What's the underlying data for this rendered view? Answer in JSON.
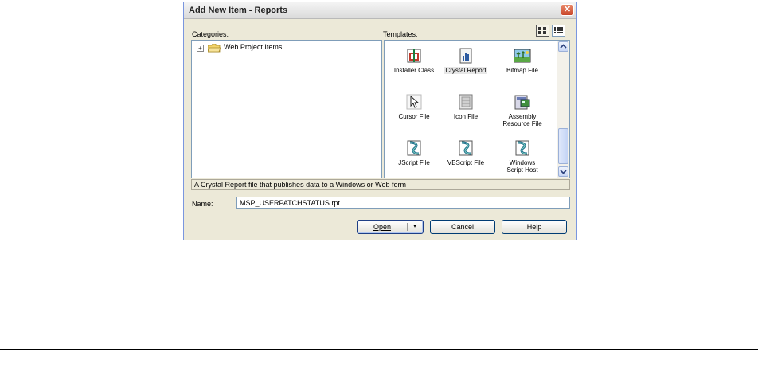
{
  "window": {
    "title": "Add New Item - Reports",
    "close_glyph": "✕"
  },
  "categories": {
    "label": "Categories:",
    "items": [
      {
        "label": "Web Project Items",
        "expander": "+",
        "icon": "folder-icon"
      }
    ]
  },
  "templates": {
    "label": "Templates:",
    "view_modes": [
      "large-icons",
      "small-icons"
    ],
    "items": [
      {
        "label": "Installer Class",
        "icon": "installer-class-icon"
      },
      {
        "label": "Crystal Report",
        "icon": "crystal-report-icon",
        "selected": true
      },
      {
        "label": "Bitmap File",
        "icon": "bitmap-file-icon"
      },
      {
        "label": "Cursor File",
        "icon": "cursor-file-icon"
      },
      {
        "label": "Icon File",
        "icon": "icon-file-icon"
      },
      {
        "label": "Assembly Resource File",
        "line1": "Assembly",
        "line2": "Resource File",
        "icon": "assembly-resource-file-icon"
      },
      {
        "label": "JScript File",
        "icon": "jscript-file-icon"
      },
      {
        "label": "VBScript File",
        "icon": "vbscript-file-icon"
      },
      {
        "label": "Windows Script Host",
        "line1": "Windows",
        "line2": "Script Host",
        "icon": "windows-script-host-icon"
      }
    ]
  },
  "description": "A Crystal Report file that publishes data to a Windows or Web form",
  "name_field": {
    "label": "Name:",
    "value": "MSP_USERPATCHSTATUS.rpt"
  },
  "buttons": {
    "open": "Open",
    "open_dropdown": "▾",
    "cancel": "Cancel",
    "help": "Help"
  },
  "colors": {
    "dialog_bg": "#ece9d8",
    "field_border": "#7f9db9",
    "close_red": "#c8452a"
  }
}
